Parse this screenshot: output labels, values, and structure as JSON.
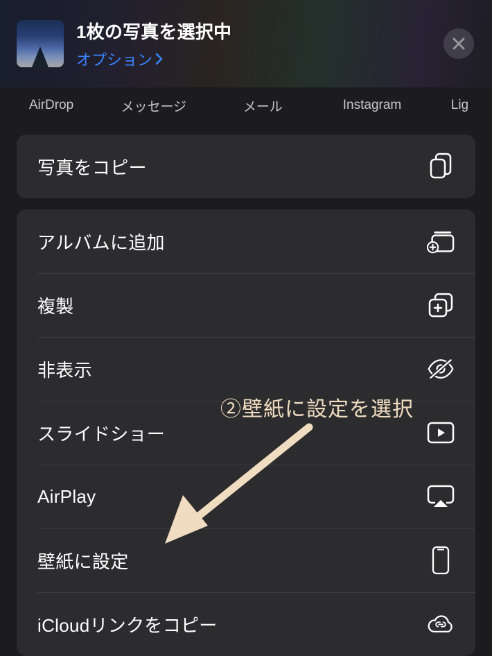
{
  "header": {
    "title": "1枚の写真を選択中",
    "subtitle": "オプション"
  },
  "share_targets": [
    "AirDrop",
    "メッセージ",
    "メール",
    "Instagram",
    "Lig"
  ],
  "actions": {
    "copy": "写真をコピー",
    "add_album": "アルバムに追加",
    "duplicate": "複製",
    "hide": "非表示",
    "slideshow": "スライドショー",
    "airplay": "AirPlay",
    "wallpaper": "壁紙に設定",
    "icloud_link": "iCloudリンクをコピー"
  },
  "annotation": "②壁紙に設定を選択"
}
